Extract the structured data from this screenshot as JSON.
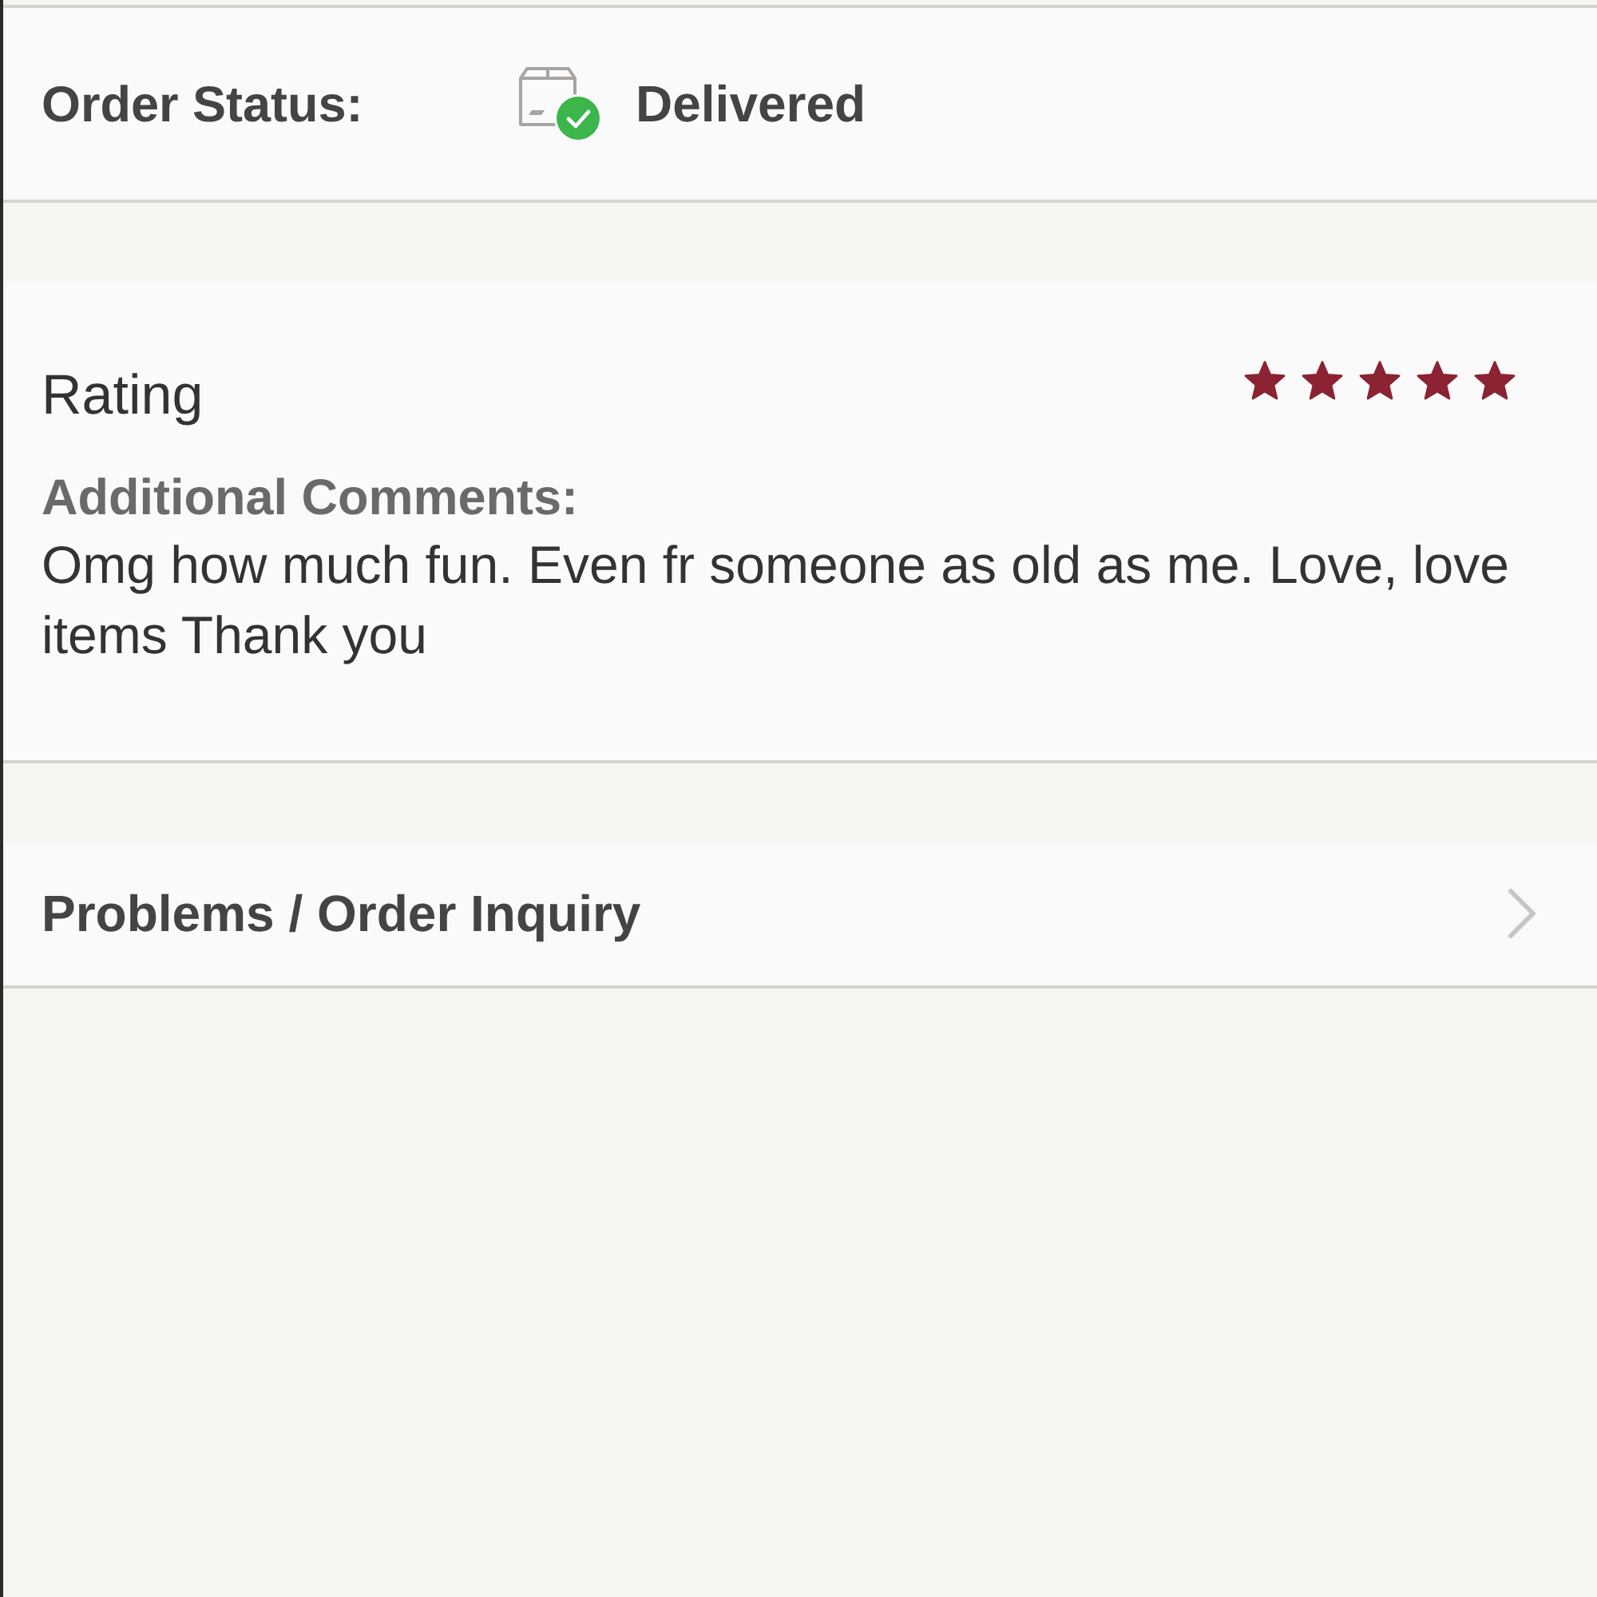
{
  "order_status": {
    "label": "Order Status:",
    "value": "Delivered"
  },
  "rating": {
    "title": "Rating",
    "stars": 5,
    "comments_label": "Additional Comments:",
    "comments": "Omg how much fun. Even fr someone as old as me. Love, love items Thank you"
  },
  "inquiry": {
    "label": "Problems / Order Inquiry"
  }
}
